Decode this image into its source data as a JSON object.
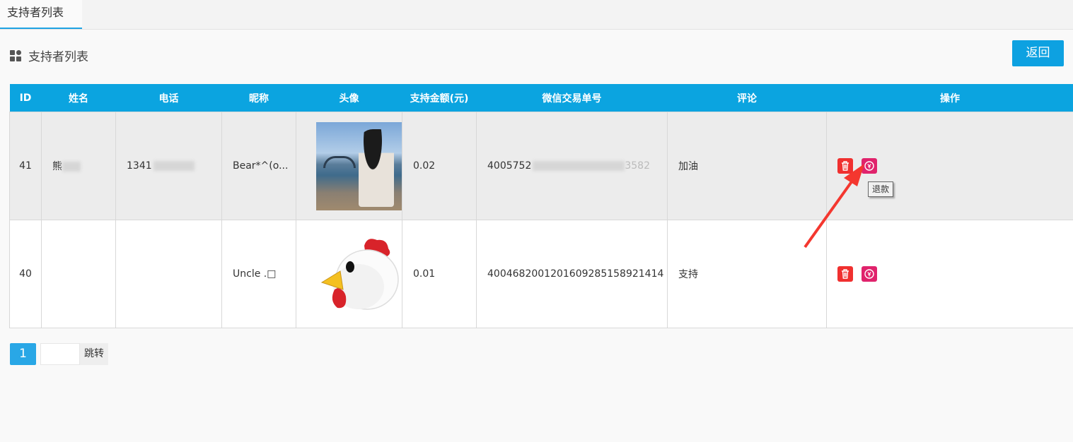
{
  "tab": {
    "label": "支持者列表"
  },
  "header": {
    "title": "支持者列表",
    "back_label": "返回"
  },
  "table": {
    "columns": [
      "ID",
      "姓名",
      "电话",
      "昵称",
      "头像",
      "支持金额(元)",
      "微信交易单号",
      "评论",
      "操作"
    ],
    "rows": [
      {
        "id": "41",
        "name": "熊",
        "phone": "1341",
        "nickname": "Bear*^(o...",
        "amount": "0.02",
        "trade_no": "4005752",
        "trade_no_tail": "3582",
        "comment": "加油"
      },
      {
        "id": "40",
        "name": "",
        "phone": "",
        "nickname": "Uncle .□",
        "amount": "0.01",
        "trade_no": "4004682001201609285158921414",
        "trade_no_tail": "",
        "comment": "支持"
      }
    ]
  },
  "tooltip": {
    "text": "退款"
  },
  "pager": {
    "current_page": "1",
    "jump_label": "跳转"
  },
  "colors": {
    "accent": "#0ba4e0",
    "delete": "#f0302f",
    "refund": "#e0236c",
    "arrow": "#f4372f"
  },
  "icons": {
    "header": "grid-icon",
    "delete": "trash-icon",
    "refund": "refund-icon"
  }
}
